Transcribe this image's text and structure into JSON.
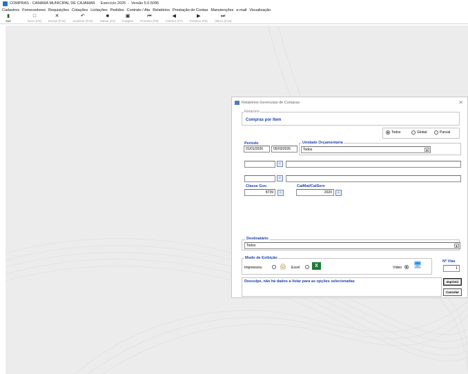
{
  "window": {
    "title": "COMPRAS - CAMARA MUNICIPAL DE CAJAMAR",
    "exercise": "Exercício 2026",
    "separator": "-",
    "version": "Versão 5.0.5095"
  },
  "menu": [
    "Cadastros",
    "Fornecedores",
    "Requisições",
    "Cotações",
    "Licitações",
    "Pedidos",
    "Contrato / Ata",
    "Relatórios",
    "Prestação de Contas",
    "Manutenções",
    "e-mail",
    "Visualização"
  ],
  "toolbar": {
    "sair": "Sair",
    "novo": "Novo (F5)",
    "excluir": "Excluir (F11)",
    "atualizar": "Atualizar (F12)",
    "salvar": "Salvar (F2)",
    "imagem": "Imagem",
    "primeiro": "Primeiro (F8)",
    "anterior": "Anterior (F7)",
    "proximo": "Próximo (F8)",
    "ultimo": "Último (F10)"
  },
  "dialog": {
    "title": "Relatórios Gerenciais de Compras",
    "relatorio_label": "Relatório",
    "relatorio_value": "Compras por Item",
    "radio_todos": "Todos",
    "radio_global": "Global",
    "radio_parcial": "Parcial",
    "periodo_label": "Período",
    "periodo_inicio": "01/01/2026",
    "periodo_fim": "05/03/2026",
    "unidade_label": "Unidade Orçamentaria",
    "unidade_value": "Todos",
    "classe_label": "Classe Gov.",
    "classe_value": "8739",
    "catmat_label": "CatMat/CatServ",
    "catmat_value": "2020",
    "destinatario_label": "Destinatário",
    "destinatario_value": "Todos",
    "modo_label": "Modo de Exibição",
    "modo_impressora": "Impressora",
    "modo_excel": "Excel",
    "modo_video": "Vídeo",
    "nvias_label": "Nº Vias",
    "nvias_value": "1",
    "message": "Desculpe, não há dados a listar para as opções selecionadas",
    "imprimir": "Imprimir",
    "cancelar": "Cancelar"
  },
  "icons": {
    "sair": "exit-door-icon",
    "novo": "new-document-icon",
    "excluir": "delete-x-icon",
    "atualizar": "refresh-icon",
    "salvar": "save-disk-icon",
    "imagem": "image-icon",
    "primeiro": "first-record-icon",
    "anterior": "previous-record-icon",
    "proximo": "next-record-icon",
    "ultimo": "last-record-icon"
  },
  "colors": {
    "accent": "#1c3fa8",
    "workspace": "#ececec",
    "excel": "#1f7a3a"
  }
}
